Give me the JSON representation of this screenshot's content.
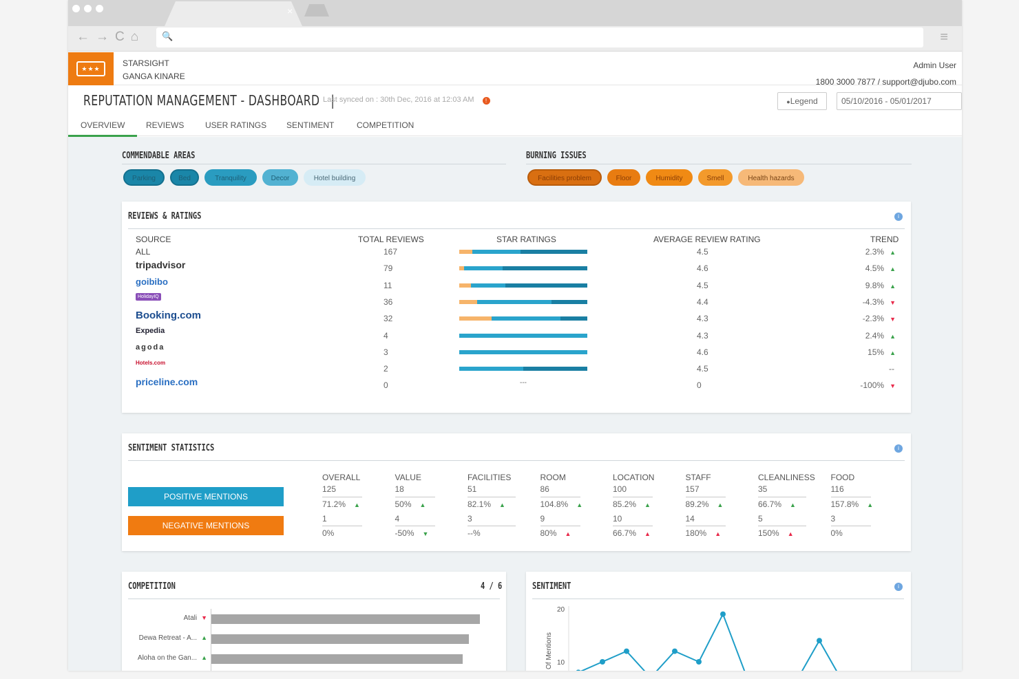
{
  "browser": {
    "tab_close": "×",
    "nav": [
      "←",
      "→",
      "C",
      "⌂"
    ],
    "search_icon": "🔍",
    "menu": "≡"
  },
  "header": {
    "hotel_name": "STARSIGHT",
    "hotel_sub": "GANGA KINARE",
    "user": "Admin User",
    "contact": "1800 3000 7877 / support@djubo.com",
    "logo_text": "★★★"
  },
  "title": {
    "page_title": "REPUTATION MANAGEMENT - DASHBOARD",
    "separator": "|",
    "last_synced": "Last synced on :   30th Dec, 2016 at 12:03 AM",
    "sync_icon": "!",
    "legend": "Legend",
    "legend_icon": "●",
    "date_range": "05/10/2016 - 05/01/2017"
  },
  "tabs": [
    "OVERVIEW",
    "REVIEWS",
    "USER RATINGS",
    "SENTIMENT",
    "COMPETITION"
  ],
  "commendable": {
    "title": "COMMENDABLE AREAS",
    "pills": [
      "Parking",
      "Bed",
      "Tranquility",
      "Decor",
      "Hotel building"
    ],
    "colors": [
      "#1a86a8",
      "#1a86a8",
      "#2a9cc0",
      "#52b2d2",
      "#d6ecf5"
    ]
  },
  "burning": {
    "title": "BURNING ISSUES",
    "pills": [
      "Facilities problem",
      "Floor",
      "Humidity",
      "Smell",
      "Health hazards"
    ],
    "colors": [
      "#d96f11",
      "#e87c11",
      "#f08a14",
      "#f39a2c",
      "#f6b978"
    ]
  },
  "reviews": {
    "title": "REVIEWS & RATINGS",
    "info": "i",
    "headers": {
      "source": "SOURCE",
      "total": "TOTAL REVIEWS",
      "stars": "STAR RATINGS",
      "avg": "AVERAGE REVIEW RATING",
      "trend": "TREND"
    },
    "rows": [
      {
        "source": "ALL",
        "total": "167",
        "avg": "4.5",
        "trend": "2.3%",
        "dir": "up",
        "bar": [
          0.1,
          0.38,
          0.52
        ]
      },
      {
        "source": "tripadvisor",
        "total": "79",
        "avg": "4.6",
        "trend": "4.5%",
        "dir": "up",
        "bar": [
          0.04,
          0.3,
          0.66
        ]
      },
      {
        "source": "goibibo",
        "total": "11",
        "avg": "4.5",
        "trend": "9.8%",
        "dir": "up",
        "bar": [
          0.09,
          0.27,
          0.64
        ]
      },
      {
        "source": "HolidayIQ",
        "total": "36",
        "avg": "4.4",
        "trend": "-4.3%",
        "dir": "down",
        "bar": [
          0.14,
          0.58,
          0.28
        ]
      },
      {
        "source": "Booking.com",
        "total": "32",
        "avg": "4.3",
        "trend": "-2.3%",
        "dir": "down",
        "bar": [
          0.25,
          0.54,
          0.21
        ]
      },
      {
        "source": "Expedia",
        "total": "4",
        "avg": "4.3",
        "trend": "2.4%",
        "dir": "up",
        "bar": [
          0,
          1,
          0
        ]
      },
      {
        "source": "agoda",
        "total": "3",
        "avg": "4.6",
        "trend": "15%",
        "dir": "up",
        "bar": [
          0,
          1,
          0
        ]
      },
      {
        "source": "Hotels.com",
        "total": "2",
        "avg": "4.5",
        "trend": "--",
        "dir": "none",
        "bar": [
          0,
          0.5,
          0.5
        ]
      },
      {
        "source": "priceline.com",
        "total": "0",
        "avg": "0",
        "trend": "-100%",
        "dir": "down",
        "bar": null,
        "bar_text": "---"
      }
    ]
  },
  "sentiment_stats": {
    "title": "SENTIMENT STATISTICS",
    "info": "i",
    "positive_label": "POSITIVE MENTIONS",
    "negative_label": "NEGATIVE MENTIONS",
    "columns": [
      {
        "name": "OVERALL",
        "pos": "125",
        "pos_pct": "71.2%",
        "pos_dir": "up",
        "neg": "1",
        "neg_pct": "0%",
        "neg_dir": "none"
      },
      {
        "name": "VALUE",
        "pos": "18",
        "pos_pct": "50%",
        "pos_dir": "up",
        "neg": "4",
        "neg_pct": "-50%",
        "neg_dir": "down-green"
      },
      {
        "name": "FACILITIES",
        "pos": "51",
        "pos_pct": "82.1%",
        "pos_dir": "up",
        "neg": "3",
        "neg_pct": "--%",
        "neg_dir": "none"
      },
      {
        "name": "ROOM",
        "pos": "86",
        "pos_pct": "104.8%",
        "pos_dir": "up",
        "neg": "9",
        "neg_pct": "80%",
        "neg_dir": "up-red"
      },
      {
        "name": "LOCATION",
        "pos": "100",
        "pos_pct": "85.2%",
        "pos_dir": "up",
        "neg": "10",
        "neg_pct": "66.7%",
        "neg_dir": "up-red"
      },
      {
        "name": "STAFF",
        "pos": "157",
        "pos_pct": "89.2%",
        "pos_dir": "up",
        "neg": "14",
        "neg_pct": "180%",
        "neg_dir": "up-red"
      },
      {
        "name": "CLEANLINESS",
        "pos": "35",
        "pos_pct": "66.7%",
        "pos_dir": "up",
        "neg": "5",
        "neg_pct": "150%",
        "neg_dir": "up-red"
      },
      {
        "name": "FOOD",
        "pos": "116",
        "pos_pct": "157.8%",
        "pos_dir": "up",
        "neg": "3",
        "neg_pct": "0%",
        "neg_dir": "none"
      }
    ]
  },
  "competition": {
    "title": "COMPETITION",
    "pager": "4 / 6",
    "items": [
      {
        "name": "Atali",
        "dir": "down",
        "value": 0.94
      },
      {
        "name": "Dewa Retreat - A...",
        "dir": "up",
        "value": 0.9
      },
      {
        "name": "Aloha on the Gan...",
        "dir": "up",
        "value": 0.88
      }
    ]
  },
  "sentiment_chart": {
    "title": "SENTIMENT",
    "info": "i",
    "chart_data": {
      "type": "line",
      "ylabel": "Of Mentions",
      "yticks": [
        "20",
        "10"
      ],
      "series": [
        {
          "values": [
            8,
            10,
            12,
            7,
            12,
            10,
            19,
            7,
            5,
            6,
            14,
            6
          ]
        }
      ],
      "color": "#1f9ec8"
    }
  },
  "glyphs": {
    "up": "▲",
    "down": "▼"
  }
}
